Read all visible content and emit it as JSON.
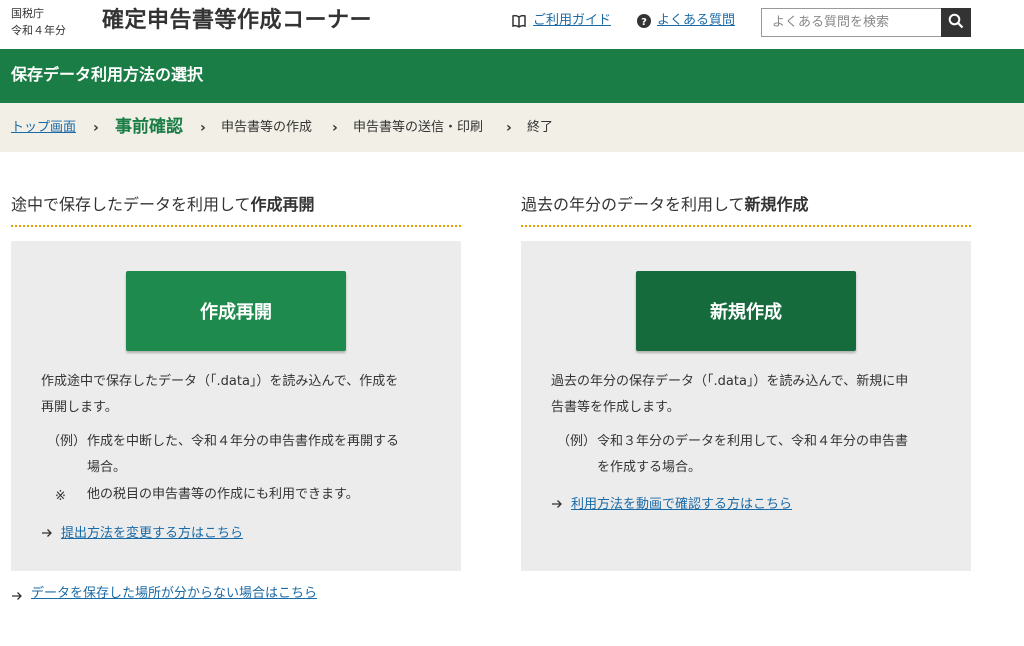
{
  "header": {
    "agency_line1": "国税庁",
    "agency_line2": "令和４年分",
    "site_title": "確定申告書等作成コーナー",
    "guide_link": "ご利用ガイド",
    "faq_link": "よくある質問",
    "search_placeholder": "よくある質問を検索"
  },
  "title_bar": {
    "text": "保存データ利用方法の選択"
  },
  "breadcrumb": {
    "items": [
      "トップ画面",
      "事前確認",
      "申告書等の作成",
      "申告書等の送信・印刷",
      "終了"
    ],
    "separator": "›"
  },
  "left": {
    "heading_plain": "途中で保存したデータを利用して",
    "heading_bold": "作成再開",
    "button_label": "作成再開",
    "desc_line1": "作成途中で保存したデータ（「.data」）を読み込んで、作成を",
    "desc_line2": "再開します。",
    "example_label": "（例）",
    "example_line1": "作成を中断した、令和４年分の申告書作成を再開する",
    "example_line2": "場合。",
    "note_mark": "※",
    "note_text": "他の税目の申告書等の作成にも利用できます。",
    "link_text": "提出方法を変更する方はこちら"
  },
  "right": {
    "heading_plain": "過去の年分のデータを利用して",
    "heading_bold": "新規作成",
    "button_label": "新規作成",
    "desc_line1": "過去の年分の保存データ（「.data」）を読み込んで、新規に申",
    "desc_line2": "告書等を作成します。",
    "example_label": "（例）",
    "example_line1": "令和３年分のデータを利用して、令和４年分の申告書",
    "example_line2": "を作成する場合。",
    "link_text": "利用方法を動画で確認する方はこちら"
  },
  "bottom_link": "データを保存した場所が分からない場合はこちら",
  "icons": {
    "guide": "book-icon",
    "faq": "question-circle-icon",
    "search": "search-icon",
    "link_arrow": "arrow-right-icon"
  },
  "colors": {
    "brand_green": "#1b7d46",
    "button_green_a": "#1f8a4d",
    "button_green_b": "#156b3c",
    "link_blue": "#1a6aa6",
    "accent_dotted": "#e0a000",
    "breadcrumb_bg": "#f1efe6",
    "panel_bg": "#ececec"
  }
}
